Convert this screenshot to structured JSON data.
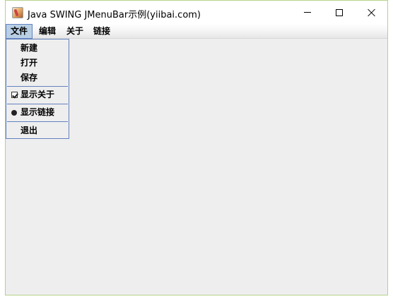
{
  "window": {
    "title": "Java SWING JMenuBar示例(yiibai.com)",
    "icon": "java-cup-icon",
    "controls": [
      "minimize-icon",
      "maximize-icon",
      "close-icon"
    ]
  },
  "menubar": {
    "items": [
      {
        "label": "文件",
        "active": true
      },
      {
        "label": "编辑"
      },
      {
        "label": "关于"
      },
      {
        "label": "链接"
      }
    ]
  },
  "popup": {
    "items": [
      {
        "label": "新建"
      },
      {
        "label": "打开"
      },
      {
        "label": "保存"
      },
      {
        "label": "显示关于",
        "type": "checkbox",
        "checked": true
      },
      {
        "label": "显示链接",
        "type": "radio",
        "selected": true
      },
      {
        "label": "退出"
      }
    ]
  },
  "colors": {
    "menu_highlight": "#b8cfe5",
    "menu_border": "#6382be",
    "window_border": "#b5d28a",
    "content_bg": "#eeeeee"
  }
}
